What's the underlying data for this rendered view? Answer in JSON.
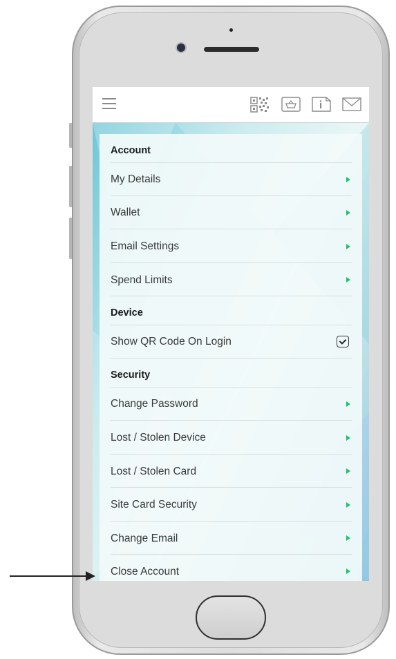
{
  "header": {
    "qr_icon": "qr-code-icon",
    "basket_icon": "basket-icon",
    "info_icon": "info-icon",
    "mail_icon": "mail-icon",
    "menu_icon": "hamburger-menu-icon"
  },
  "menu": {
    "sections": [
      {
        "title": "Account",
        "items": [
          {
            "label": "My Details",
            "type": "arrow"
          },
          {
            "label": "Wallet",
            "type": "arrow"
          },
          {
            "label": "Email Settings",
            "type": "arrow"
          },
          {
            "label": "Spend Limits",
            "type": "arrow"
          }
        ]
      },
      {
        "title": "Device",
        "items": [
          {
            "label": "Show QR Code On Login",
            "type": "checkbox",
            "checked": true
          }
        ]
      },
      {
        "title": "Security",
        "items": [
          {
            "label": "Change Password",
            "type": "arrow"
          },
          {
            "label": "Lost / Stolen Device",
            "type": "arrow"
          },
          {
            "label": "Lost / Stolen Card",
            "type": "arrow"
          },
          {
            "label": "Site Card Security",
            "type": "arrow"
          },
          {
            "label": "Change Email",
            "type": "arrow"
          },
          {
            "label": "Close Account",
            "type": "arrow"
          }
        ]
      }
    ]
  },
  "colors": {
    "arrow": "#1ec46b",
    "background_accent": "#9fdde3"
  }
}
